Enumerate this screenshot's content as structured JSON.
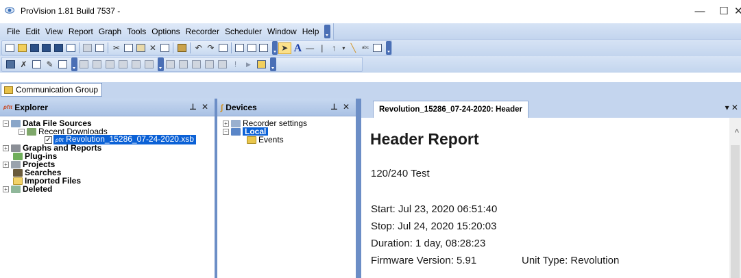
{
  "window": {
    "title": "ProVision 1.81 Build 7537 -",
    "minimize": "—",
    "maximize": "☐",
    "close": "✕"
  },
  "menu": [
    "File",
    "Edit",
    "View",
    "Report",
    "Graph",
    "Tools",
    "Options",
    "Recorder",
    "Scheduler",
    "Window",
    "Help"
  ],
  "communication_group": "Communication Group",
  "explorer": {
    "title": "Explorer",
    "pin": "⊥",
    "close": "✕",
    "items": {
      "data_file_sources": "Data File Sources",
      "recent_downloads": "Recent Downloads",
      "file": "Revolution_15286_07-24-2020.xsb",
      "graphs_reports": "Graphs and Reports",
      "plugins": "Plug-ins",
      "projects": "Projects",
      "searches": "Searches",
      "imported_files": "Imported Files",
      "deleted": "Deleted"
    }
  },
  "devices": {
    "title": "Devices",
    "pin": "⊥",
    "close": "✕",
    "items": {
      "recorder_settings": "Recorder settings",
      "local": "Local",
      "events": "Events"
    }
  },
  "report": {
    "tab": "Revolution_15286_07-24-2020: Header",
    "heading": "Header Report",
    "test_name": "120/240 Test",
    "start": "Start: Jul 23, 2020 06:51:40",
    "stop": "Stop: Jul 24, 2020 15:20:03",
    "duration": "Duration: 1 day, 08:28:23",
    "firmware": "Firmware Version: 5.91",
    "unit_type": "Unit Type:  Revolution"
  },
  "colors": {
    "chrome": "#c4d5ee",
    "selection": "#0b61d6",
    "splitter": "#6c8ec6"
  }
}
